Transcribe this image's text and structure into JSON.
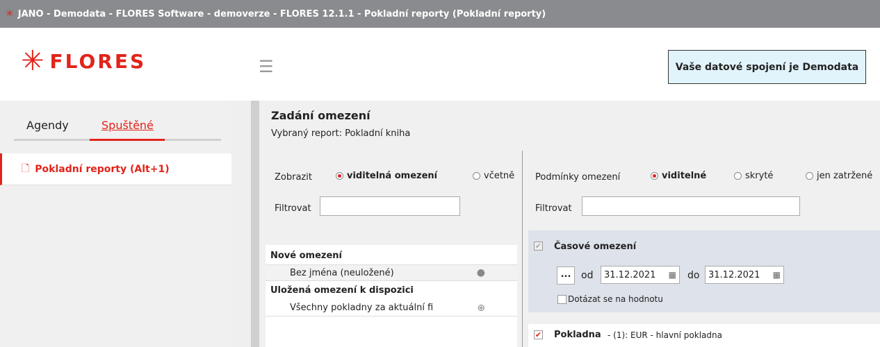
{
  "window": {
    "title": "JANO - Demodata - FLORES Software - demoverze - FLORES 12.1.1 - Pokladní reporty  (Pokladní reporty)"
  },
  "header": {
    "logo_text": "FLORES",
    "connection_label": "Vaše datové spojení je Demodata"
  },
  "sidebar": {
    "tabs": [
      {
        "label": "Agendy"
      },
      {
        "label": "Spuštěné"
      }
    ],
    "items": [
      {
        "label": "Pokladní reporty (Alt+1)"
      }
    ]
  },
  "main": {
    "title": "Zadání omezení",
    "subtitle": "Vybraný report: Pokladní kniha",
    "show_label": "Zobrazit",
    "show_options": [
      {
        "label": "viditelná omezení",
        "selected": true
      },
      {
        "label": "včetně",
        "selected": false
      }
    ],
    "filter_label": "Filtrovat",
    "filter_value": "",
    "list": {
      "new_header": "Nové omezení",
      "new_item": "Bez jména (neuložené)",
      "saved_header": "Uložená omezení k dispozici",
      "saved_item": "Všechny pokladny za aktuální fi"
    }
  },
  "conditions": {
    "label": "Podmínky omezení",
    "options": [
      {
        "label": "viditelné",
        "selected": true
      },
      {
        "label": "skryté",
        "selected": false
      },
      {
        "label": "jen zatržené",
        "selected": false
      }
    ],
    "filter_label": "Filtrovat",
    "filter_value": "",
    "time": {
      "title": "Časové omezení",
      "btn": "...",
      "from_label": "od",
      "from_value": "31.12.2021",
      "to_label": "do",
      "to_value": "31.12.2021",
      "ask_label": "Dotázat se na hodnotu"
    },
    "cashbox": {
      "title": "Pokladna",
      "detail": "- (1): EUR - hlavní pokladna"
    }
  },
  "colors": {
    "accent": "#e2231a",
    "titlebar": "#898b8e",
    "connection_bg": "#e1f3fb"
  }
}
